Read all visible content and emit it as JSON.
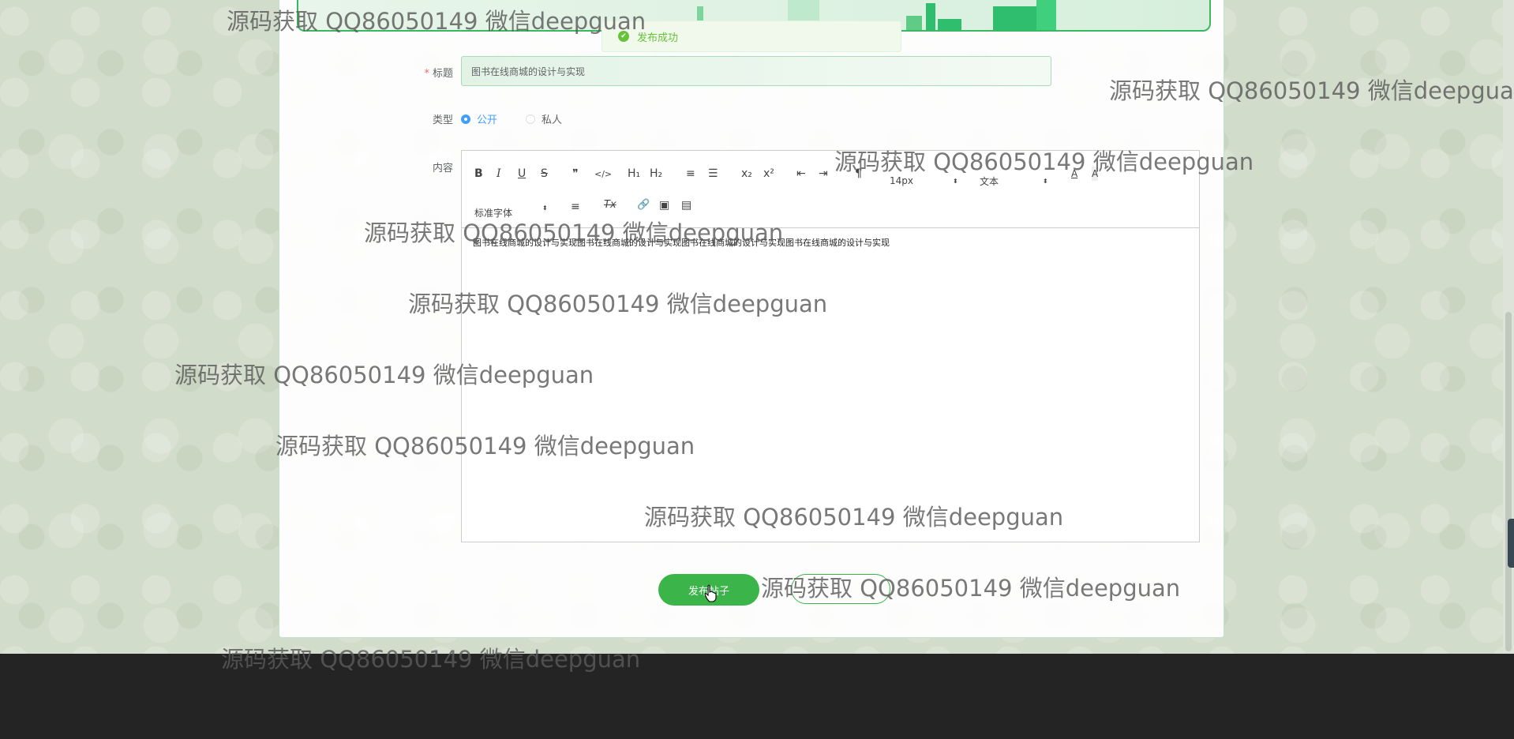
{
  "toast": {
    "message": "发布成功",
    "icon": "success-check-icon"
  },
  "form": {
    "title_label": "标题",
    "title_required_mark": "*",
    "title_value": "图书在线商城的设计与实现",
    "type_label": "类型",
    "type_options": [
      "公开",
      "私人"
    ],
    "type_selected": "公开",
    "content_label": "内容"
  },
  "editor": {
    "toolbar": {
      "bold": "B",
      "italic": "I",
      "underline": "U",
      "strike": "S",
      "blockquote": "❞",
      "code": "</>",
      "h1": "H₁",
      "h2": "H₂",
      "ordered_list": "≡",
      "bullet_list": "☰",
      "subscript": "x₂",
      "superscript": "x²",
      "outdent": "⇤",
      "indent": "⇥",
      "direction": "¶",
      "size_value": "14px",
      "header_value": "文本",
      "font_value": "标准字体",
      "color": "A",
      "background": "A",
      "align": "≡",
      "clean": "Tx",
      "link": "🔗",
      "image": "▣",
      "video": "▤"
    },
    "content": "图书在线商城的设计与实现图书在线商城的设计与实现图书在线商城的设计与实现图书在线商城的设计与实现"
  },
  "buttons": {
    "publish": "发布帖子"
  },
  "watermark": "源码获取 QQ86050149 微信deepguan"
}
